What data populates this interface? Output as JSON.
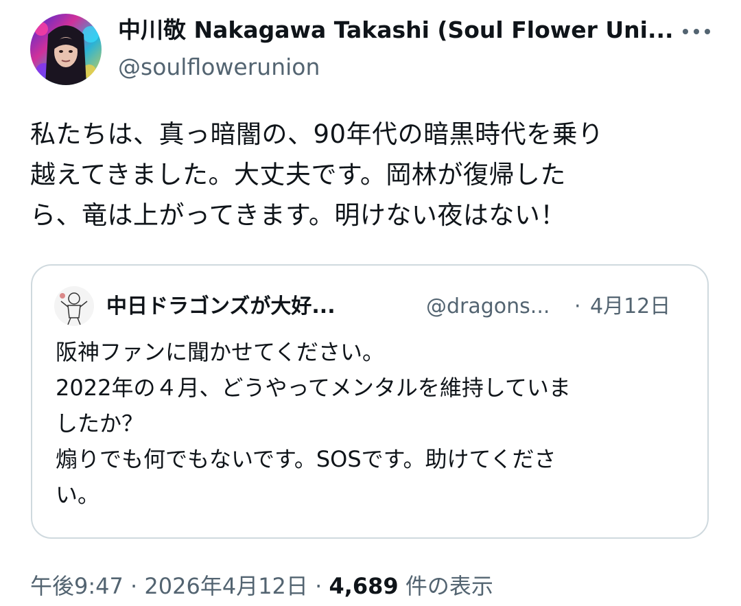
{
  "author": {
    "name": "中川敬 Nakagawa Takashi (Soul Flower Uni...",
    "handle": "@soulflowerunion"
  },
  "tweet": {
    "lines": [
      "私たちは、真っ暗闇の、90年代の暗黒時代を乗り",
      "越えてきました。大丈夫です。岡林が復帰した",
      "ら、竜は上がってきます。明けない夜はない！"
    ]
  },
  "quote": {
    "name": "中日ドラゴンズが大好...",
    "handle": "@dragons...",
    "separator": "·",
    "date": "4月12日",
    "lines": [
      "阪神ファンに聞かせてください。",
      "2022年の４月、どうやってメンタルを維持していま",
      "したか？",
      "煽りでも何でもないです。SOSです。助けてくださ",
      "い。"
    ]
  },
  "meta": {
    "time": "午後9:47",
    "separator1": " · ",
    "date": "2026年4月12日",
    "separator2": " · ",
    "views_count": "4,689",
    "views_label": " 件の表示"
  },
  "icons": {
    "more": "more-horizontal-icon",
    "avatar": "author-avatar",
    "quote_avatar": "quote-author-avatar"
  },
  "colors": {
    "text_primary": "#0f1419",
    "text_secondary": "#536471",
    "border": "#cfd9de"
  }
}
